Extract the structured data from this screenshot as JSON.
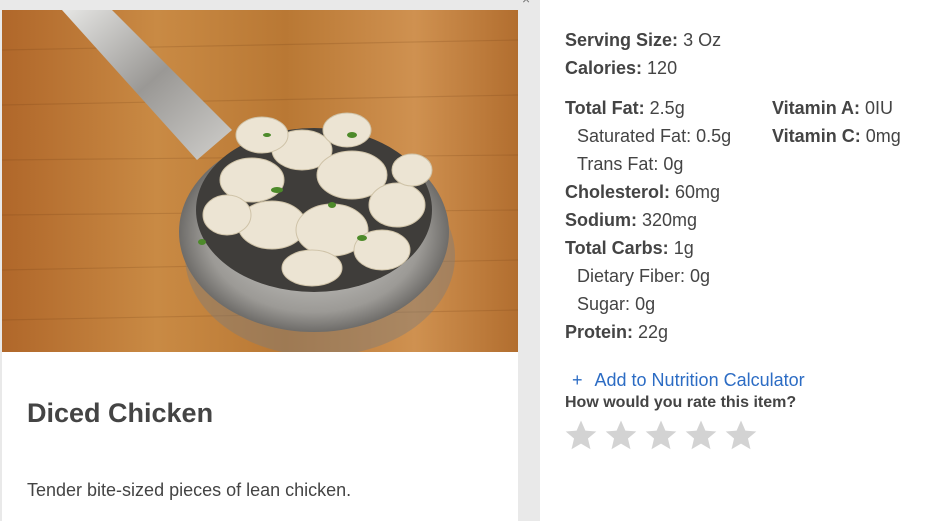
{
  "food": {
    "name": "Diced Chicken",
    "description": "Tender bite-sized pieces of lean chicken."
  },
  "nutrition": {
    "serving_size_label": "Serving Size:",
    "serving_size_value": "3 Oz",
    "calories_label": "Calories:",
    "calories_value": "120",
    "total_fat_label": "Total Fat:",
    "total_fat_value": "2.5g",
    "saturated_fat_label": "Saturated Fat:",
    "saturated_fat_value": "0.5g",
    "trans_fat_label": "Trans Fat:",
    "trans_fat_value": "0g",
    "cholesterol_label": "Cholesterol:",
    "cholesterol_value": "60mg",
    "sodium_label": "Sodium:",
    "sodium_value": "320mg",
    "total_carbs_label": "Total Carbs:",
    "total_carbs_value": "1g",
    "dietary_fiber_label": "Dietary Fiber:",
    "dietary_fiber_value": "0g",
    "sugar_label": "Sugar:",
    "sugar_value": "0g",
    "protein_label": "Protein:",
    "protein_value": "22g",
    "vitamin_a_label": "Vitamin A:",
    "vitamin_a_value": "0IU",
    "vitamin_c_label": "Vitamin C:",
    "vitamin_c_value": "0mg"
  },
  "actions": {
    "add_to_calculator_icon": "plus-icon",
    "add_to_calculator_label": "Add to Nutrition Calculator",
    "rate_question": "How would you rate this item?",
    "rating_max": 5,
    "rating_value": 0
  },
  "colors": {
    "link": "#2c6cc4",
    "star_empty": "#d3d3d3",
    "text": "#444444"
  }
}
